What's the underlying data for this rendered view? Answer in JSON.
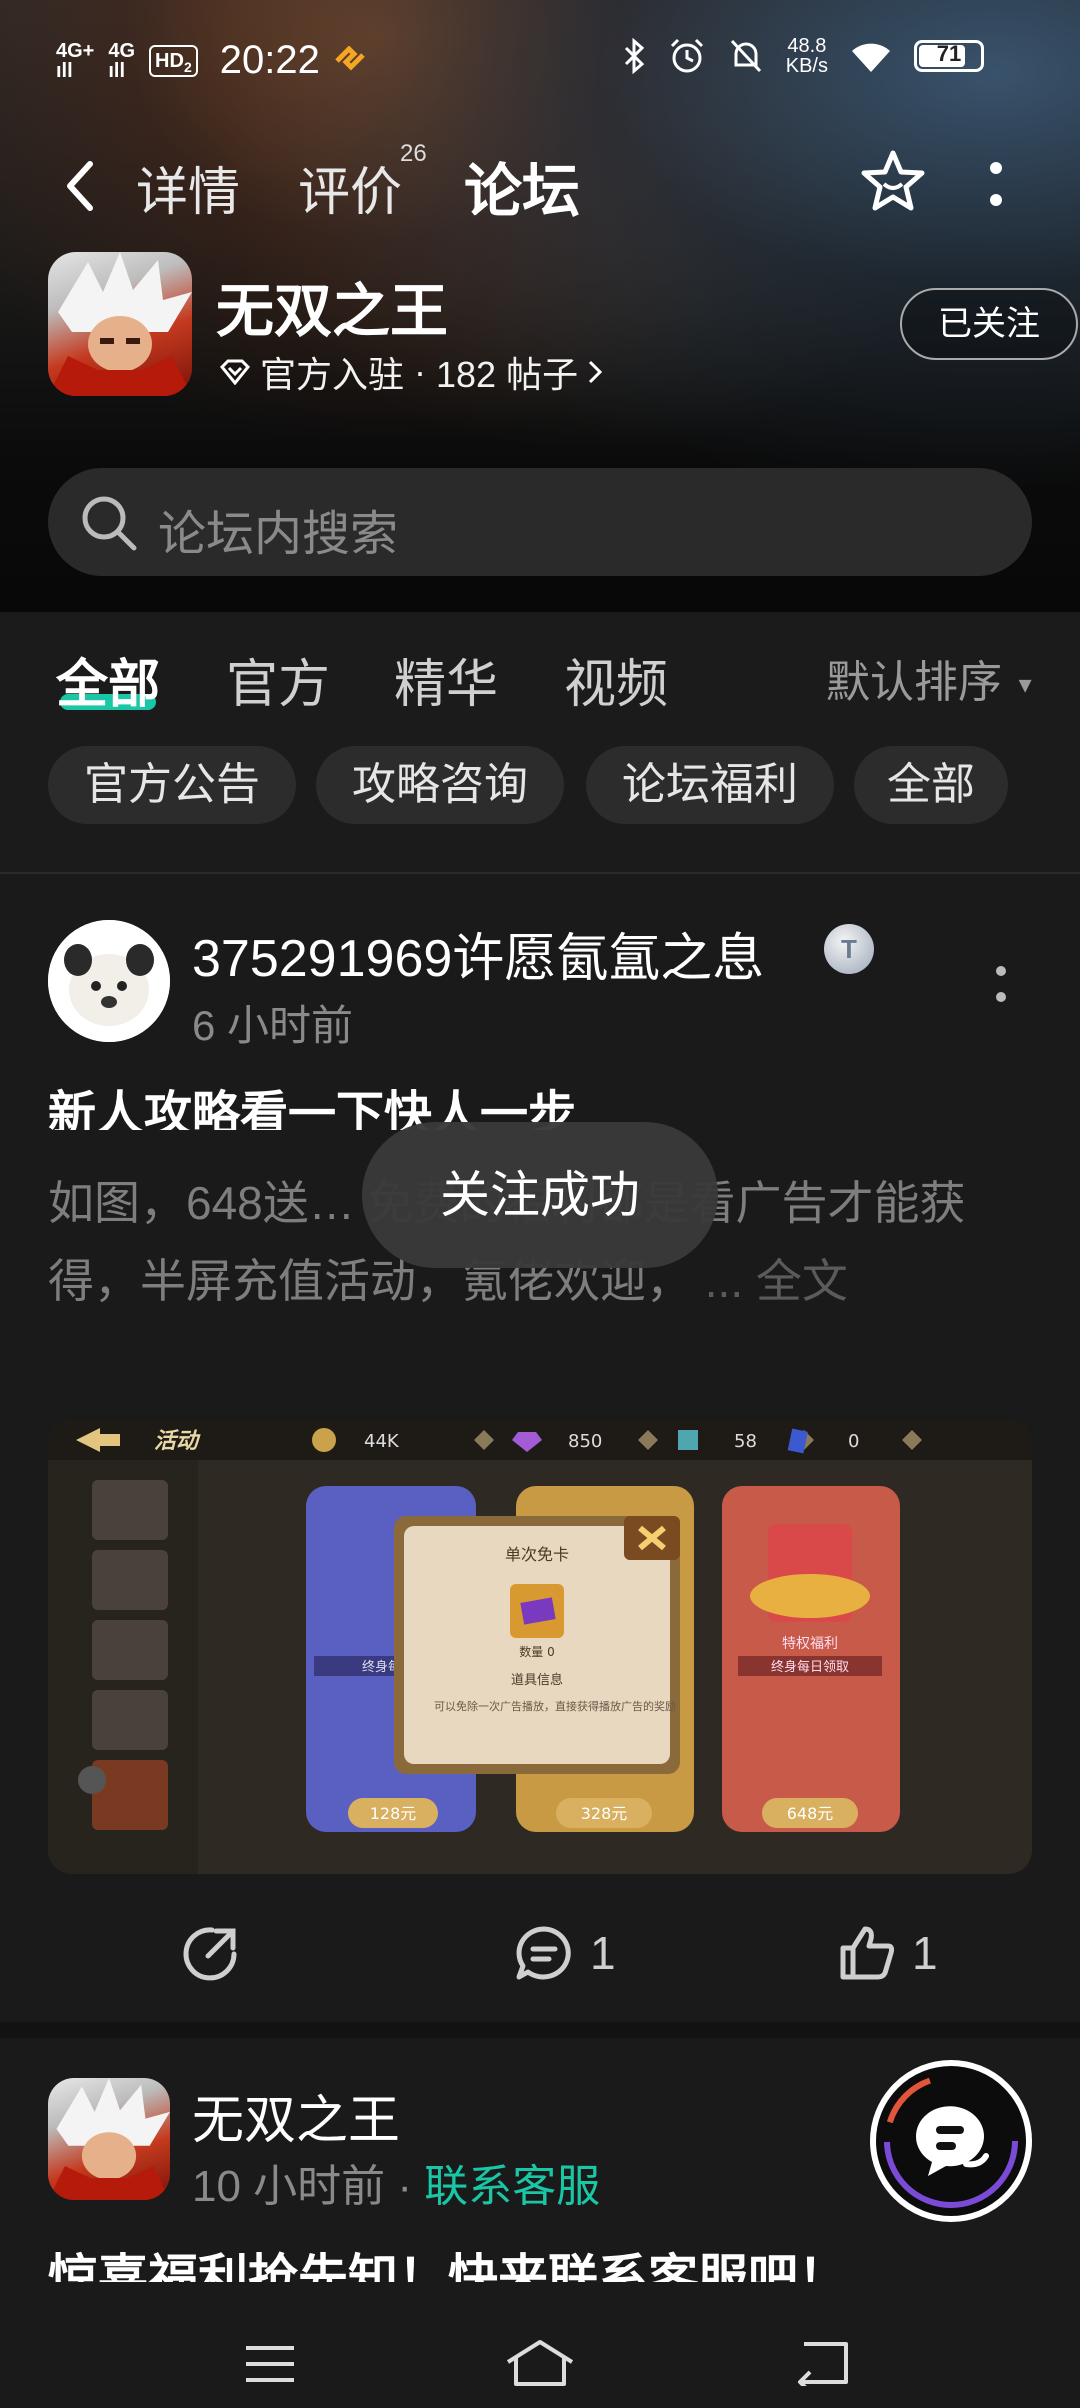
{
  "status_bar": {
    "network1": "4G+",
    "network2": "4G",
    "hd_label": "HD",
    "hd_sub": "2",
    "time": "20:22",
    "speed_value": "48.8",
    "speed_unit": "KB/s",
    "battery": "71"
  },
  "nav": {
    "tabs": [
      {
        "label": "详情"
      },
      {
        "label": "评价"
      },
      {
        "label": "论坛"
      }
    ],
    "review_count": "26",
    "active_tab": "论坛"
  },
  "game": {
    "title": "无双之王",
    "verified_text": "官方入驻",
    "separator": "·",
    "post_count_text": "182 帖子",
    "follow_label": "已关注"
  },
  "search": {
    "placeholder": "论坛内搜索"
  },
  "filter_tabs": [
    {
      "label": "全部"
    },
    {
      "label": "官方"
    },
    {
      "label": "精华"
    },
    {
      "label": "视频"
    }
  ],
  "sort_label": "默认排序",
  "chips": [
    {
      "label": "官方公告"
    },
    {
      "label": "攻略咨询"
    },
    {
      "label": "论坛福利"
    },
    {
      "label": "全部"
    }
  ],
  "post1": {
    "username": "375291969许愿氤氲之息",
    "badge": "T",
    "time": "6 小时前",
    "title": "新人攻略看一下快人一步",
    "body": "如图，648送… 免费的福利都是看广告才能获得，半屏充值活动，氪佬欢迎，",
    "more": "... 全文",
    "image": {
      "header": "活动",
      "coins": "44K",
      "gems": "850",
      "cubes": "58",
      "cards": "0",
      "popup_title": "单次免卡",
      "popup_qty": "数量 0",
      "popup_info_title": "道具信息",
      "popup_info": "可以免除一次广告播放，直接获得播放广告的奖励",
      "price1": "128元",
      "price2": "328元",
      "price3": "648元",
      "card3_label": "特权福利",
      "card3_sub": "终身每日领取",
      "card1_sub": "终身每日"
    },
    "comments": "1",
    "likes": "1"
  },
  "toast": "关注成功",
  "post2": {
    "username": "无双之王",
    "time": "10 小时前",
    "separator": "·",
    "link": "联系客服",
    "title": "惊喜福利抢先知！快来联系客服吧！"
  },
  "colors": {
    "accent": "#19c7a6",
    "background": "#1a1a1a",
    "chip": "#2c2c2c"
  }
}
